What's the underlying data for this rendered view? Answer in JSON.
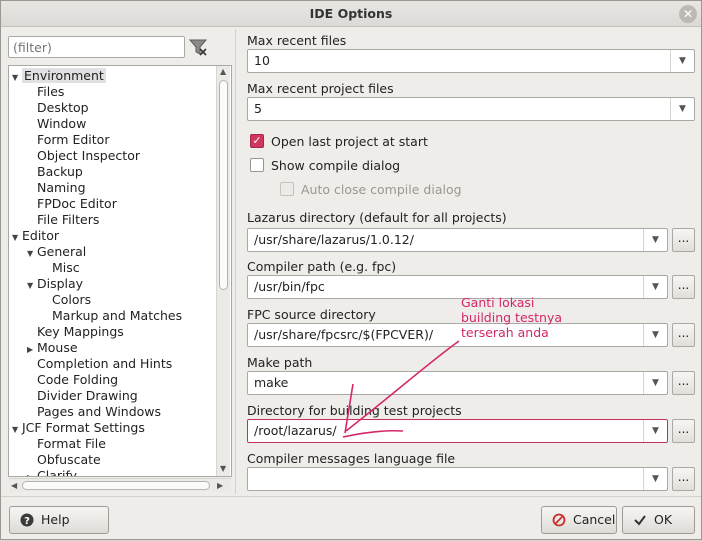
{
  "window": {
    "title": "IDE Options",
    "close_glyph": "✕"
  },
  "filter": {
    "placeholder": "(filter)"
  },
  "tree": {
    "items": [
      {
        "label": "Environment",
        "level": 0,
        "expander": "▼",
        "selected": true
      },
      {
        "label": "Files",
        "level": 1
      },
      {
        "label": "Desktop",
        "level": 1
      },
      {
        "label": "Window",
        "level": 1
      },
      {
        "label": "Form Editor",
        "level": 1
      },
      {
        "label": "Object Inspector",
        "level": 1
      },
      {
        "label": "Backup",
        "level": 1
      },
      {
        "label": "Naming",
        "level": 1
      },
      {
        "label": "FPDoc Editor",
        "level": 1
      },
      {
        "label": "File Filters",
        "level": 1
      },
      {
        "label": "Editor",
        "level": 0,
        "expander": "▼"
      },
      {
        "label": "General",
        "level": 1,
        "expander": "▼"
      },
      {
        "label": "Misc",
        "level": 2
      },
      {
        "label": "Display",
        "level": 1,
        "expander": "▼"
      },
      {
        "label": "Colors",
        "level": 2
      },
      {
        "label": "Markup and Matches",
        "level": 2
      },
      {
        "label": "Key Mappings",
        "level": 1
      },
      {
        "label": "Mouse",
        "level": 1,
        "expander": "▶"
      },
      {
        "label": "Completion and Hints",
        "level": 1
      },
      {
        "label": "Code Folding",
        "level": 1
      },
      {
        "label": "Divider Drawing",
        "level": 1
      },
      {
        "label": "Pages and Windows",
        "level": 1
      },
      {
        "label": "JCF Format Settings",
        "level": 0,
        "expander": "▼"
      },
      {
        "label": "Format File",
        "level": 1
      },
      {
        "label": "Obfuscate",
        "level": 1
      },
      {
        "label": "Clarify",
        "level": 1,
        "expander": "▶"
      }
    ]
  },
  "fields": {
    "max_recent_files": {
      "label": "Max recent files",
      "value": "10"
    },
    "max_recent_project_files": {
      "label": "Max recent project files",
      "value": "5"
    },
    "open_last_project": {
      "label": "Open last project at start",
      "checked": true
    },
    "show_compile_dialog": {
      "label": "Show compile dialog",
      "checked": false
    },
    "auto_close_compile_dialog": {
      "label": "Auto close compile dialog",
      "checked": false,
      "disabled": true
    },
    "lazarus_dir": {
      "label": "Lazarus directory (default for all projects)",
      "value": "/usr/share/lazarus/1.0.12/"
    },
    "compiler_path": {
      "label": "Compiler path (e.g. fpc)",
      "value": "/usr/bin/fpc"
    },
    "fpc_source_dir": {
      "label": "FPC source directory",
      "value": "/usr/share/fpcsrc/$(FPCVER)/"
    },
    "make_path": {
      "label": "Make path",
      "value": "make"
    },
    "test_build_dir": {
      "label": "Directory for building test projects",
      "value": "/root/lazarus/"
    },
    "compiler_messages_file": {
      "label": "Compiler messages language file",
      "value": ""
    }
  },
  "buttons": {
    "help": "Help",
    "cancel": "Cancel",
    "ok": "OK",
    "dots": "..."
  },
  "annotation": {
    "text": "Ganti lokasi\nbuilding testnya\nterserah anda",
    "color": "#d3276a"
  },
  "colors": {
    "accent": "#d1365e",
    "annotation": "#d3276a"
  }
}
